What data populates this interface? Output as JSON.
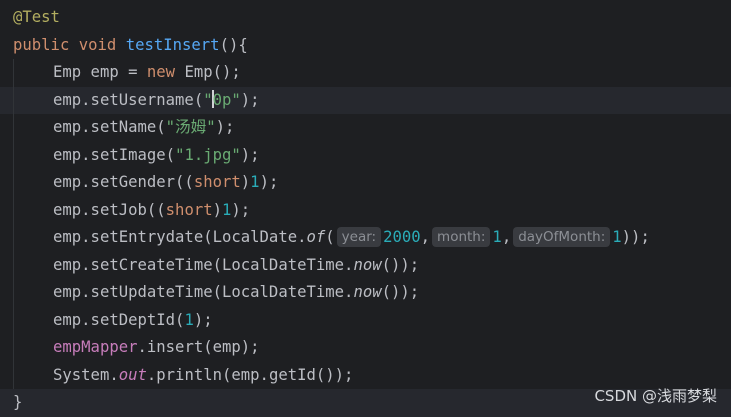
{
  "editor": {
    "line_annotation": "@Test",
    "line_signature": {
      "kw_public": "public",
      "kw_void": "void",
      "method_name": "testInsert",
      "tail": "(){"
    },
    "line_new_emp": {
      "text_a": "Emp emp = ",
      "kw_new": "new",
      "text_b": " Emp();"
    },
    "line_username": {
      "pre": "emp.setUsername(",
      "str_open": "\"",
      "str_rest": "0p\"",
      "post": ");"
    },
    "line_name": {
      "pre": "emp.setName(",
      "str": "\"汤姆\"",
      "post": ");"
    },
    "line_image": {
      "pre": "emp.setImage(",
      "str": "\"1.jpg\"",
      "post": ");"
    },
    "line_gender": {
      "pre": "emp.setGender((",
      "kw": "short",
      "mid": ")",
      "num": "1",
      "post": ");"
    },
    "line_job": {
      "pre": "emp.setJob((",
      "kw": "short",
      "mid": ")",
      "num": "1",
      "post": ");"
    },
    "line_entrydate": {
      "pre": "emp.setEntrydate(LocalDate.",
      "method": "of",
      "paren": "(",
      "hint_year": "year:",
      "val_year": "2000",
      "sep1": ",",
      "hint_month": "month:",
      "val_month": "1",
      "sep2": ",",
      "hint_day": "dayOfMonth:",
      "val_day": "1",
      "post": "));"
    },
    "line_createtime": {
      "pre": "emp.setCreateTime(LocalDateTime.",
      "method": "now",
      "post": "());"
    },
    "line_updatetime": {
      "pre": "emp.setUpdateTime(LocalDateTime.",
      "method": "now",
      "post": "());"
    },
    "line_deptid": {
      "pre": "emp.setDeptId(",
      "num": "1",
      "post": ");"
    },
    "line_insert": {
      "field": "empMapper",
      "post": ".insert(emp);"
    },
    "line_println": {
      "pre": "System.",
      "field": "out",
      "post": ".println(emp.getId());"
    },
    "line_close": "}"
  },
  "watermark": "CSDN @浅雨梦梨"
}
